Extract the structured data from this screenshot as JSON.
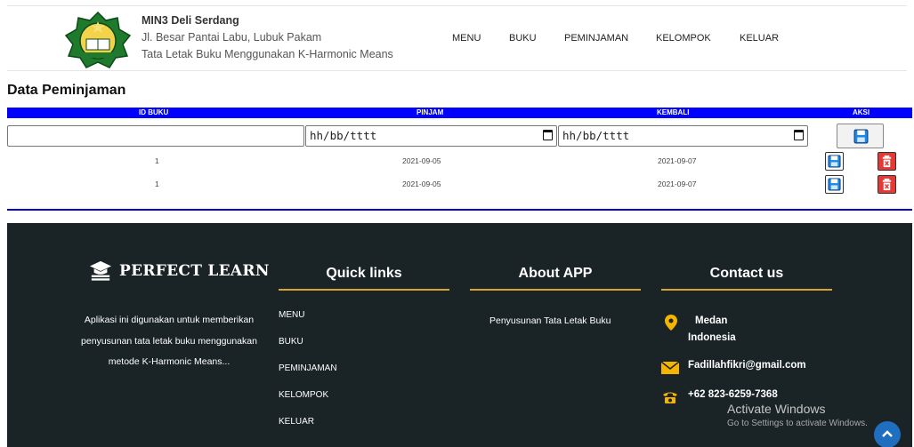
{
  "header": {
    "school_name": "MIN3 Deli Serdang",
    "address": "Jl. Besar Pantai Labu, Lubuk Pakam",
    "subtitle": "Tata Letak Buku Menggunakan K-Harmonic Means",
    "nav": [
      "MENU",
      "BUKU",
      "PEMINJAMAN",
      "KELOMPOK",
      "KELUAR"
    ]
  },
  "page_title": "Data Peminjaman",
  "table": {
    "columns": [
      "ID BUKU",
      "PINJAM",
      "KEMBALI",
      "AKSI"
    ],
    "filter": {
      "id_buku": "",
      "pinjam_placeholder": "hh/bb/tttt",
      "kembali_placeholder": "hh/bb/tttt"
    },
    "rows": [
      {
        "id_buku": "1",
        "pinjam": "2021-09-05",
        "kembali": "2021-09-07"
      },
      {
        "id_buku": "1",
        "pinjam": "2021-09-05",
        "kembali": "2021-09-07"
      }
    ]
  },
  "footer": {
    "brand": "PERFECT LEARN",
    "description": "Aplikasi ini digunakan untuk memberikan penyusunan tata letak buku menggunakan metode K-Harmonic Means...",
    "quick_links_title": "Quick links",
    "quick_links": [
      "MENU",
      "BUKU",
      "PEMINJAMAN",
      "KELOMPOK",
      "KELUAR"
    ],
    "about_title": "About APP",
    "about_text": "Penyusunan Tata Letak Buku",
    "contact_title": "Contact us",
    "location_line1": "Medan",
    "location_line2": "Indonesia",
    "email": "Fadillahfikri@gmail.com",
    "phone": "+62 823-6259-7368",
    "accent_color": "#d4a72c"
  },
  "os_watermark": {
    "line1": "Activate Windows",
    "line2": "Go to Settings to activate Windows."
  },
  "colors": {
    "table_header": "#0000ff",
    "footer_bg": "#1a2426"
  }
}
